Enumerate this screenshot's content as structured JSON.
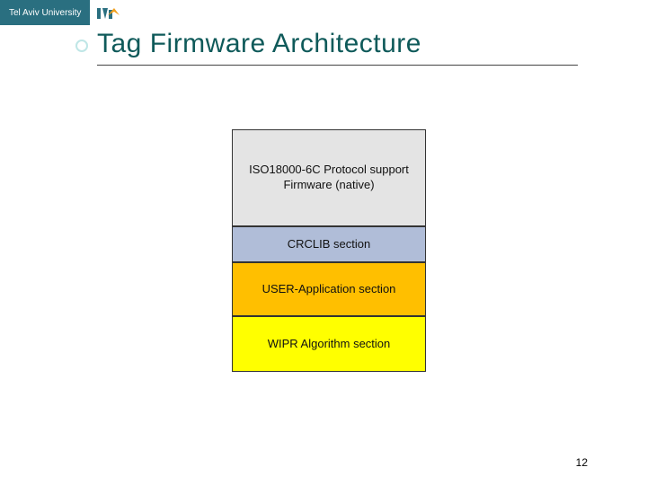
{
  "branding": {
    "university": "Tel Aviv University"
  },
  "title": "Tag Firmware Architecture",
  "layers": {
    "iso_line1": "ISO18000-6C Protocol support",
    "iso_line2": "Firmware (native)",
    "crc": "CRCLIB section",
    "user": "USER-Application section",
    "wipr": "WIPR Algorithm section"
  },
  "page_number": "12"
}
